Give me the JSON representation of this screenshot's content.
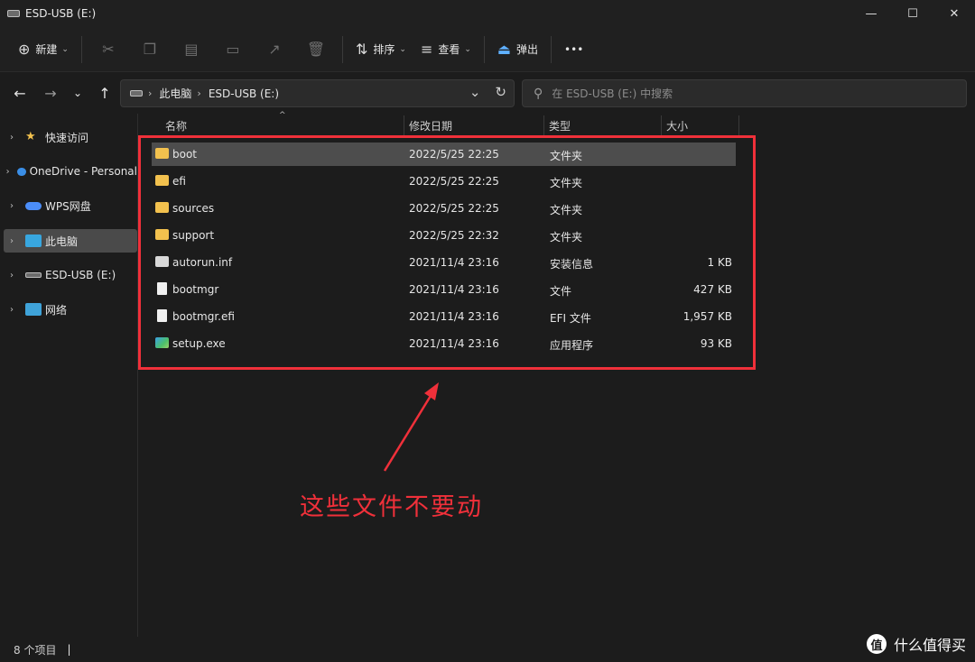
{
  "window": {
    "title": "ESD-USB (E:)",
    "controls": [
      "—",
      "☐",
      "✕"
    ]
  },
  "toolbar": {
    "new_label": "新建",
    "sort_label": "排序",
    "view_label": "查看",
    "eject_label": "弹出",
    "more_label": "•••"
  },
  "address": {
    "segments": [
      "此电脑",
      "ESD-USB (E:)"
    ]
  },
  "search": {
    "placeholder": "在 ESD-USB (E:) 中搜索"
  },
  "sidebar": {
    "items": [
      {
        "label": "快速访问",
        "icon": "star-icon"
      },
      {
        "label": "OneDrive - Personal",
        "icon": "onedrive-cloud-icon"
      },
      {
        "label": "WPS网盘",
        "icon": "wps-cloud-icon"
      },
      {
        "label": "此电脑",
        "icon": "this-pc-icon"
      },
      {
        "label": "ESD-USB (E:)",
        "icon": "usb-drive-icon"
      },
      {
        "label": "网络",
        "icon": "network-icon"
      }
    ]
  },
  "columns": {
    "name": "名称",
    "date": "修改日期",
    "type": "类型",
    "size": "大小"
  },
  "files": [
    {
      "name": "boot",
      "date": "2022/5/25 22:25",
      "type": "文件夹",
      "size": "",
      "icon": "folder-icon"
    },
    {
      "name": "efi",
      "date": "2022/5/25 22:25",
      "type": "文件夹",
      "size": "",
      "icon": "folder-icon"
    },
    {
      "name": "sources",
      "date": "2022/5/25 22:25",
      "type": "文件夹",
      "size": "",
      "icon": "folder-icon"
    },
    {
      "name": "support",
      "date": "2022/5/25 22:32",
      "type": "文件夹",
      "size": "",
      "icon": "folder-icon"
    },
    {
      "name": "autorun.inf",
      "date": "2021/11/4 23:16",
      "type": "安装信息",
      "size": "1 KB",
      "icon": "setup-info-icon"
    },
    {
      "name": "bootmgr",
      "date": "2021/11/4 23:16",
      "type": "文件",
      "size": "427 KB",
      "icon": "file-icon"
    },
    {
      "name": "bootmgr.efi",
      "date": "2021/11/4 23:16",
      "type": "EFI 文件",
      "size": "1,957 KB",
      "icon": "file-icon"
    },
    {
      "name": "setup.exe",
      "date": "2021/11/4 23:16",
      "type": "应用程序",
      "size": "93 KB",
      "icon": "setup-exe-icon"
    }
  ],
  "annotation": {
    "text": "这些文件不要动",
    "color": "#f0303a"
  },
  "status": {
    "count": "8 个项目"
  },
  "watermark": {
    "logo": "值",
    "text": "什么值得买"
  }
}
